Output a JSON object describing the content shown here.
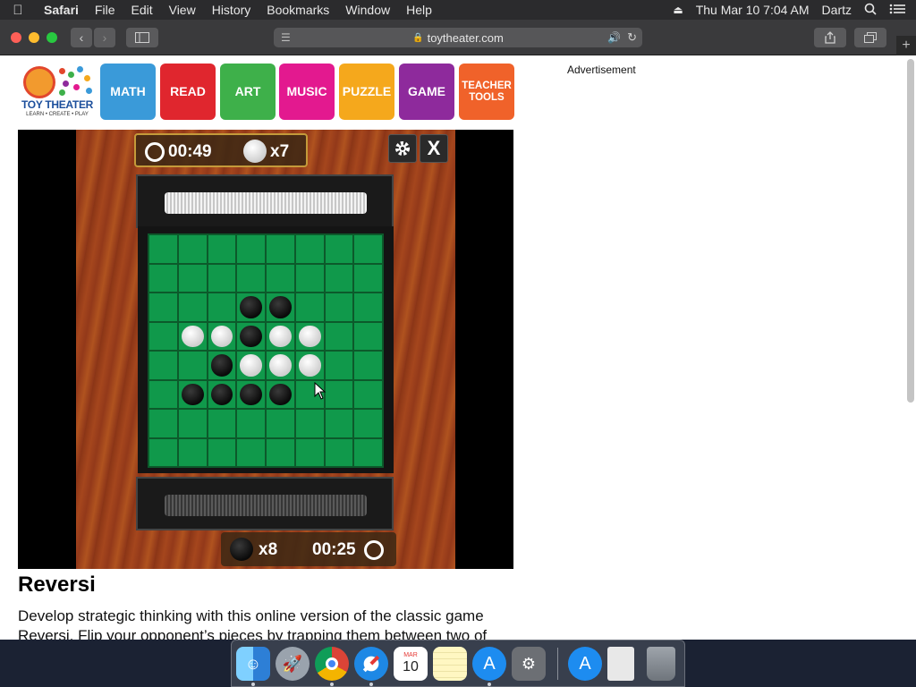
{
  "menubar": {
    "app_name": "Safari",
    "items": [
      "File",
      "Edit",
      "View",
      "History",
      "Bookmarks",
      "Window",
      "Help"
    ],
    "datetime": "Thu Mar 10  7:04 AM",
    "user": "Dartz"
  },
  "browser": {
    "url": "toytheater.com"
  },
  "site": {
    "logo_text": "TOY THEATER",
    "logo_tagline": "LEARN • CREATE • PLAY",
    "categories": [
      {
        "label": "MATH",
        "color": "#3a9ad9"
      },
      {
        "label": "READ",
        "color": "#e0262e"
      },
      {
        "label": "ART",
        "color": "#3eb04a"
      },
      {
        "label": "MUSIC",
        "color": "#e3198f"
      },
      {
        "label": "PUZZLE",
        "color": "#f5a81c"
      },
      {
        "label": "GAME",
        "color": "#8e2a9c"
      },
      {
        "label": "TEACHER TOOLS",
        "color": "#f0622a"
      }
    ],
    "advertisement_label": "Advertisement"
  },
  "game": {
    "top_timer": "00:49",
    "top_count": "x7",
    "bottom_count": "x8",
    "bottom_timer": "00:25",
    "settings_icon": "gear-icon",
    "close_label": "X",
    "board": [
      [
        "",
        "",
        "",
        "",
        "",
        "",
        "",
        ""
      ],
      [
        "",
        "",
        "",
        "",
        "",
        "",
        "",
        ""
      ],
      [
        "",
        "",
        "",
        "B",
        "B",
        "",
        "",
        ""
      ],
      [
        "",
        "W",
        "W",
        "B",
        "W",
        "W",
        "",
        ""
      ],
      [
        "",
        "",
        "B",
        "W",
        "W",
        "W",
        "",
        ""
      ],
      [
        "",
        "B",
        "B",
        "B",
        "B",
        "",
        "",
        ""
      ],
      [
        "",
        "",
        "",
        "",
        "",
        "",
        "",
        ""
      ],
      [
        "",
        "",
        "",
        "",
        "",
        "",
        "",
        ""
      ]
    ]
  },
  "content": {
    "title": "Reversi",
    "description": "Develop strategic thinking with this online version of the classic game Reversi.  Flip your opponent’s pieces by trapping them between two of"
  },
  "dock": {
    "calendar_month": "MAR",
    "calendar_day": "10"
  }
}
